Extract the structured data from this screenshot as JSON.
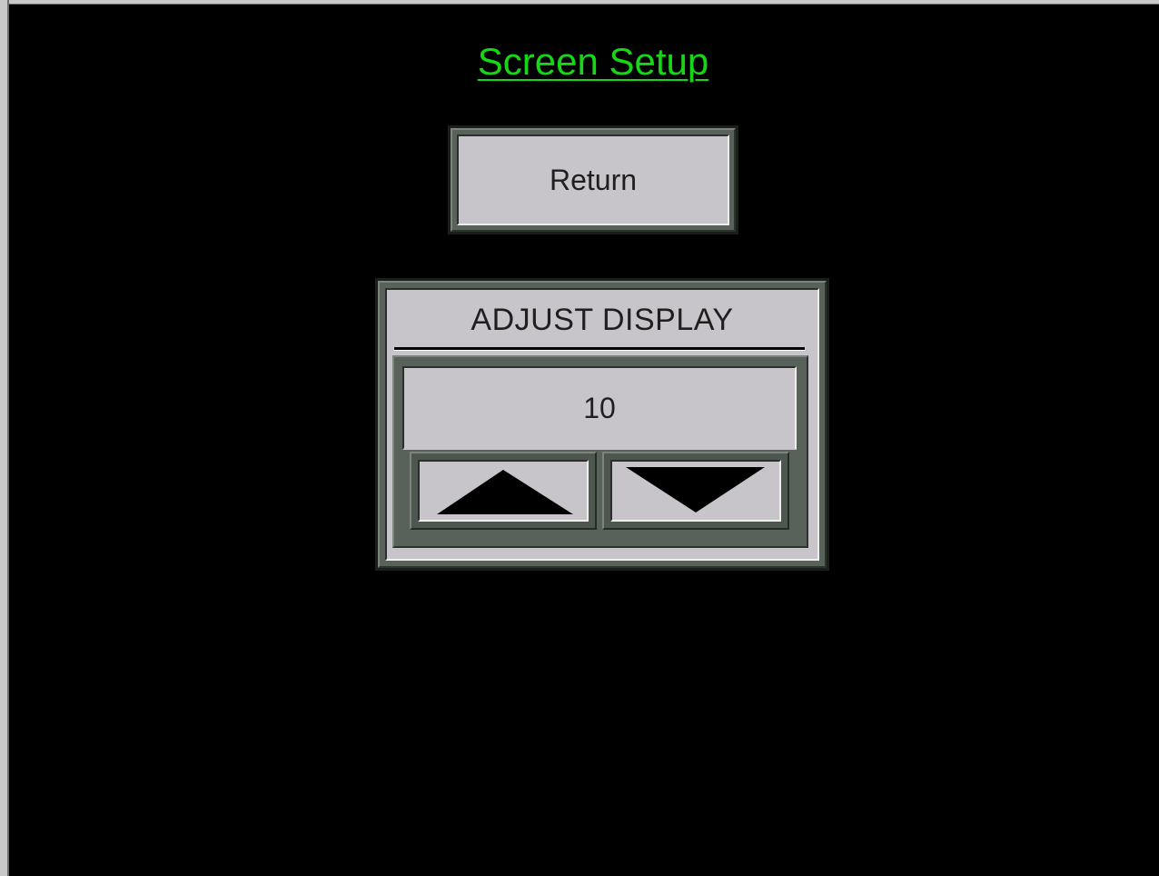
{
  "screen": {
    "title": "Screen Setup",
    "title_color": "#16d616",
    "background": "#000000"
  },
  "return_button": {
    "label": "Return"
  },
  "adjust_panel": {
    "title": "ADJUST DISPLAY",
    "value": "10",
    "up_icon": "triangle-up-icon",
    "down_icon": "triangle-down-icon"
  }
}
